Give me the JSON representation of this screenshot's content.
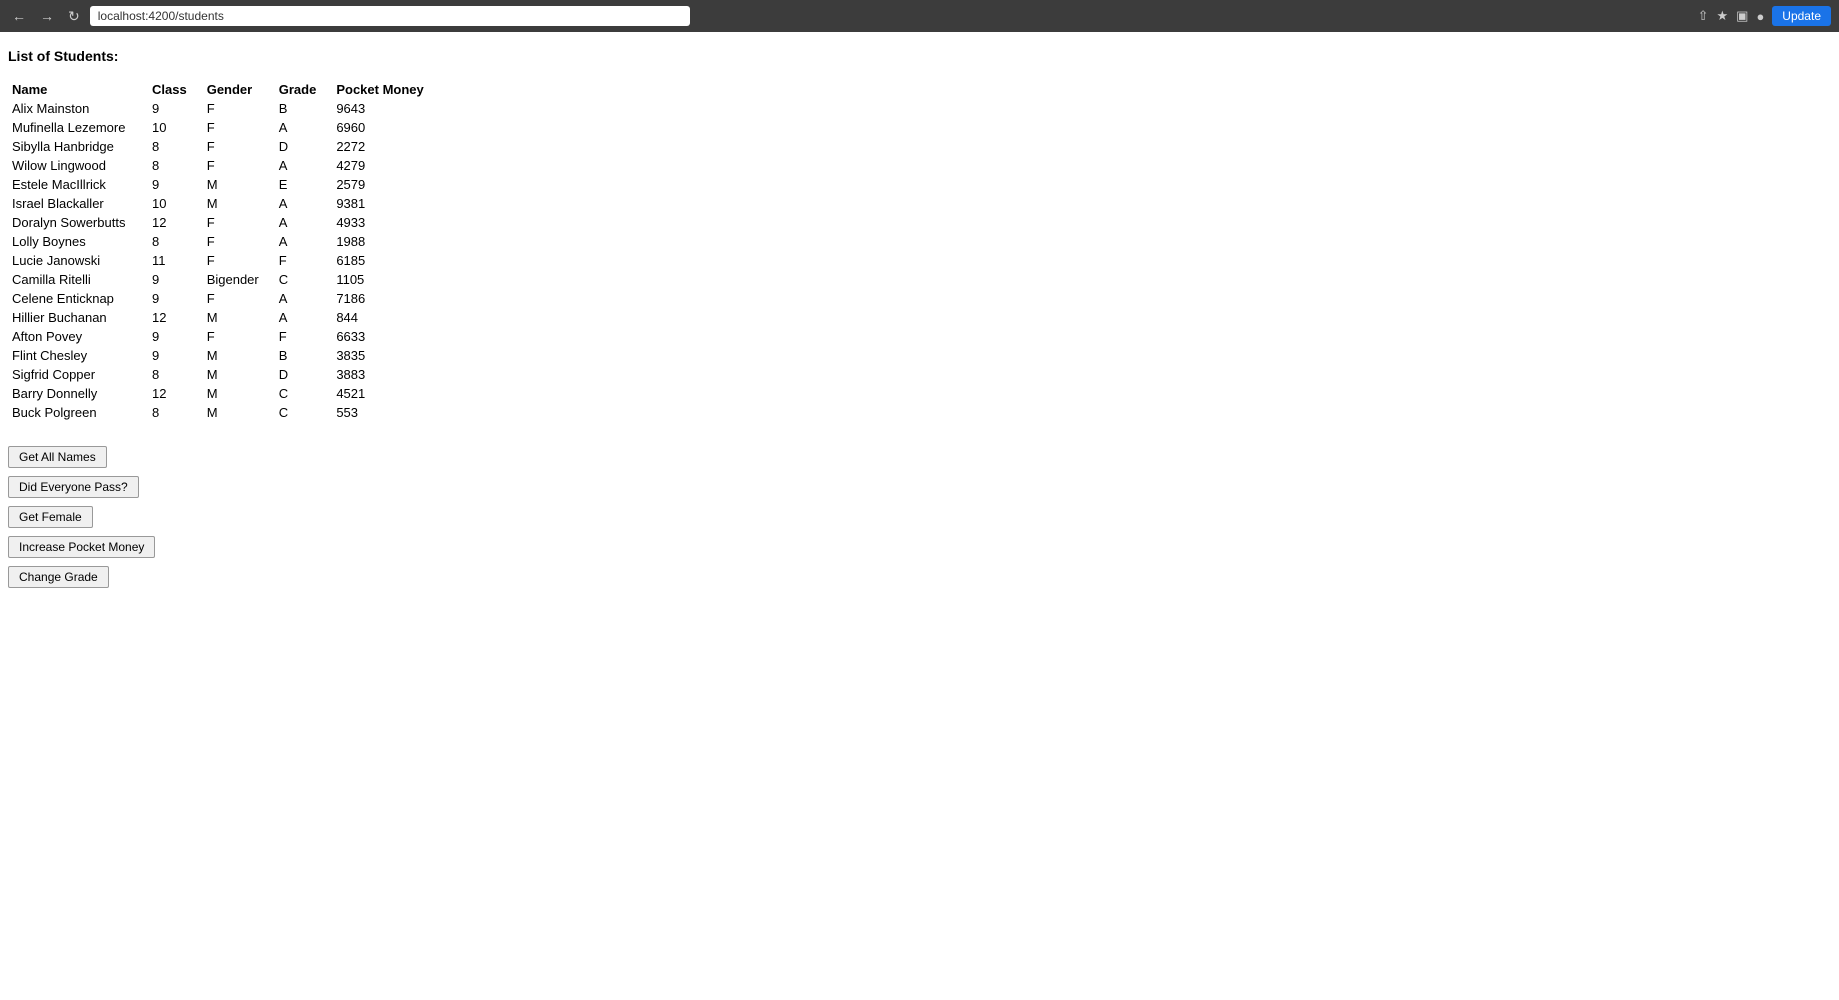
{
  "browser": {
    "url": "localhost:4200/students",
    "update_label": "Update"
  },
  "page": {
    "title": "List of Students:"
  },
  "table": {
    "headers": [
      "Name",
      "Class",
      "Gender",
      "Grade",
      "Pocket Money"
    ],
    "rows": [
      {
        "name": "Alix Mainston",
        "class": "9",
        "gender": "F",
        "grade": "B",
        "pocket_money": "9643"
      },
      {
        "name": "Mufinella Lezemore",
        "class": "10",
        "gender": "F",
        "grade": "A",
        "pocket_money": "6960"
      },
      {
        "name": "Sibylla Hanbridge",
        "class": "8",
        "gender": "F",
        "grade": "D",
        "pocket_money": "2272"
      },
      {
        "name": "Wilow Lingwood",
        "class": "8",
        "gender": "F",
        "grade": "A",
        "pocket_money": "4279"
      },
      {
        "name": "Estele MacIllrick",
        "class": "9",
        "gender": "M",
        "grade": "E",
        "pocket_money": "2579"
      },
      {
        "name": "Israel Blackaller",
        "class": "10",
        "gender": "M",
        "grade": "A",
        "pocket_money": "9381"
      },
      {
        "name": "Doralyn Sowerbutts",
        "class": "12",
        "gender": "F",
        "grade": "A",
        "pocket_money": "4933"
      },
      {
        "name": "Lolly Boynes",
        "class": "8",
        "gender": "F",
        "grade": "A",
        "pocket_money": "1988"
      },
      {
        "name": "Lucie Janowski",
        "class": "11",
        "gender": "F",
        "grade": "F",
        "pocket_money": "6185"
      },
      {
        "name": "Camilla Ritelli",
        "class": "9",
        "gender": "Bigender",
        "grade": "C",
        "pocket_money": "1105"
      },
      {
        "name": "Celene Enticknap",
        "class": "9",
        "gender": "F",
        "grade": "A",
        "pocket_money": "7186"
      },
      {
        "name": "Hillier Buchanan",
        "class": "12",
        "gender": "M",
        "grade": "A",
        "pocket_money": "844"
      },
      {
        "name": "Afton Povey",
        "class": "9",
        "gender": "F",
        "grade": "F",
        "pocket_money": "6633"
      },
      {
        "name": "Flint Chesley",
        "class": "9",
        "gender": "M",
        "grade": "B",
        "pocket_money": "3835"
      },
      {
        "name": "Sigfrid Copper",
        "class": "8",
        "gender": "M",
        "grade": "D",
        "pocket_money": "3883"
      },
      {
        "name": "Barry Donnelly",
        "class": "12",
        "gender": "M",
        "grade": "C",
        "pocket_money": "4521"
      },
      {
        "name": "Buck Polgreen",
        "class": "8",
        "gender": "M",
        "grade": "C",
        "pocket_money": "553"
      }
    ]
  },
  "buttons": {
    "get_all_names": "Get All Names",
    "did_everyone_pass": "Did Everyone Pass?",
    "get_female": "Get Female",
    "increase_pocket_money": "Increase Pocket Money",
    "change_grade": "Change Grade"
  }
}
